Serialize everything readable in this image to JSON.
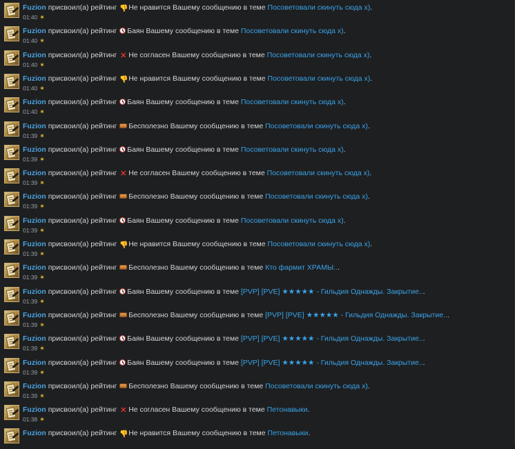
{
  "common": {
    "user": "Fuzion",
    "assigned": "присвоил(а) рейтинг",
    "message_in_topic": "Вашему сообщению в теме"
  },
  "items": [
    {
      "rating_icon": "dislike-hand-icon",
      "rating": "Не нравится",
      "topic": "Посоветовали скинуть сюда х)",
      "time": "01:40"
    },
    {
      "rating_icon": "clock-icon",
      "rating": "Баян",
      "topic": "Посоветовали скинуть сюда х)",
      "time": "01:40"
    },
    {
      "rating_icon": "cross-icon",
      "rating": "Не согласен",
      "topic": "Посоветовали скинуть сюда х)",
      "time": "01:40"
    },
    {
      "rating_icon": "dislike-hand-icon",
      "rating": "Не нравится",
      "topic": "Посоветовали скинуть сюда х)",
      "time": "01:40"
    },
    {
      "rating_icon": "clock-icon",
      "rating": "Баян",
      "topic": "Посоветовали скинуть сюда х)",
      "time": "01:40"
    },
    {
      "rating_icon": "box-icon",
      "rating": "Бесполезно",
      "topic": "Посоветовали скинуть сюда х)",
      "time": "01:39"
    },
    {
      "rating_icon": "clock-icon",
      "rating": "Баян",
      "topic": "Посоветовали скинуть сюда х)",
      "time": "01:39"
    },
    {
      "rating_icon": "cross-icon",
      "rating": "Не согласен",
      "topic": "Посоветовали скинуть сюда х)",
      "time": "01:39"
    },
    {
      "rating_icon": "box-icon",
      "rating": "Бесполезно",
      "topic": "Посоветовали скинуть сюда х)",
      "time": "01:39"
    },
    {
      "rating_icon": "clock-icon",
      "rating": "Баян",
      "topic": "Посоветовали скинуть сюда х)",
      "time": "01:39"
    },
    {
      "rating_icon": "dislike-hand-icon",
      "rating": "Не нравится",
      "topic": "Посоветовали скинуть сюда х)",
      "time": "01:39"
    },
    {
      "rating_icon": "box-icon",
      "rating": "Бесполезно",
      "topic": "Кто фармит ХРАМЫ..",
      "time": "01:39"
    },
    {
      "rating_icon": "clock-icon",
      "rating": "Баян",
      "topic": "[PVP] [PVE] ★★★★★ - Гильдия Однажды. Закрытие..",
      "time": "01:39"
    },
    {
      "rating_icon": "box-icon",
      "rating": "Бесполезно",
      "topic": "[PVP] [PVE] ★★★★★ - Гильдия Однажды. Закрытие..",
      "time": "01:39"
    },
    {
      "rating_icon": "clock-icon",
      "rating": "Баян",
      "topic": "[PVP] [PVE] ★★★★★ - Гильдия Однажды. Закрытие..",
      "time": "01:39"
    },
    {
      "rating_icon": "clock-icon",
      "rating": "Баян",
      "topic": "[PVP] [PVE] ★★★★★ - Гильдия Однажды. Закрытие..",
      "time": "01:39"
    },
    {
      "rating_icon": "box-icon",
      "rating": "Бесполезно",
      "topic": "Посоветовали скинуть сюда х)",
      "time": "01:39"
    },
    {
      "rating_icon": "cross-icon",
      "rating": "Не согласен",
      "topic": "Петонавыки",
      "time": "01:38"
    },
    {
      "rating_icon": "dislike-hand-icon",
      "rating": "Не нравится",
      "topic": "Петонавыки",
      "time": ""
    }
  ]
}
